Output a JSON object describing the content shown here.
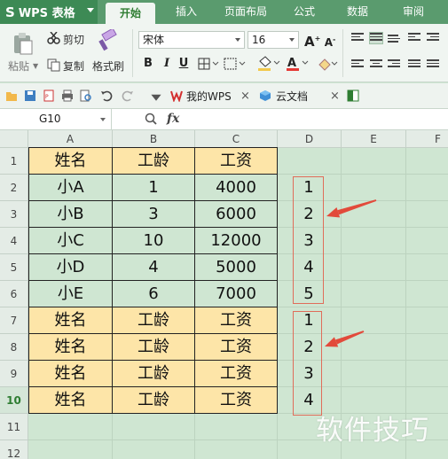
{
  "app": {
    "logo": "WPS 表格"
  },
  "tabs": [
    {
      "label": "开始",
      "active": true
    },
    {
      "label": "插入"
    },
    {
      "label": "页面布局"
    },
    {
      "label": "公式"
    },
    {
      "label": "数据"
    },
    {
      "label": "审阅"
    }
  ],
  "ribbon": {
    "paste": "粘贴",
    "cut": "剪切",
    "copy": "复制",
    "format_painter": "格式刷",
    "font_name": "宋体",
    "font_size": "16",
    "bold": "B",
    "italic": "I",
    "underline": "U",
    "font_grow": "A",
    "font_shrink": "A"
  },
  "qat": {
    "doc_tabs": [
      {
        "label": "我的WPS"
      },
      {
        "label": "云文档"
      }
    ]
  },
  "formula_bar": {
    "cell_ref": "G10",
    "fx": "fx"
  },
  "columns": [
    "A",
    "B",
    "C",
    "D",
    "E",
    "F"
  ],
  "rows": [
    "1",
    "2",
    "3",
    "4",
    "5",
    "6",
    "7",
    "8",
    "9",
    "10",
    "11",
    "12"
  ],
  "selected_row": "10",
  "table": {
    "r1": [
      "姓名",
      "工龄",
      "工资"
    ],
    "r2": [
      "小A",
      "1",
      "4000"
    ],
    "r3": [
      "小B",
      "3",
      "6000"
    ],
    "r4": [
      "小C",
      "10",
      "12000"
    ],
    "r5": [
      "小D",
      "4",
      "5000"
    ],
    "r6": [
      "小E",
      "6",
      "7000"
    ],
    "r7": [
      "姓名",
      "工龄",
      "工资"
    ],
    "r8": [
      "姓名",
      "工龄",
      "工资"
    ],
    "r9": [
      "姓名",
      "工龄",
      "工资"
    ],
    "r10": [
      "姓名",
      "工龄",
      "工资"
    ]
  },
  "column_d": [
    "1",
    "2",
    "3",
    "4",
    "5",
    "1",
    "2",
    "3",
    "4"
  ],
  "watermark": "软件技巧",
  "colors": {
    "accent": "#5a9b6e",
    "header_fill": "#fde5a8",
    "sheet_bg": "#cfe6d2",
    "annotation": "#e06d5a"
  }
}
